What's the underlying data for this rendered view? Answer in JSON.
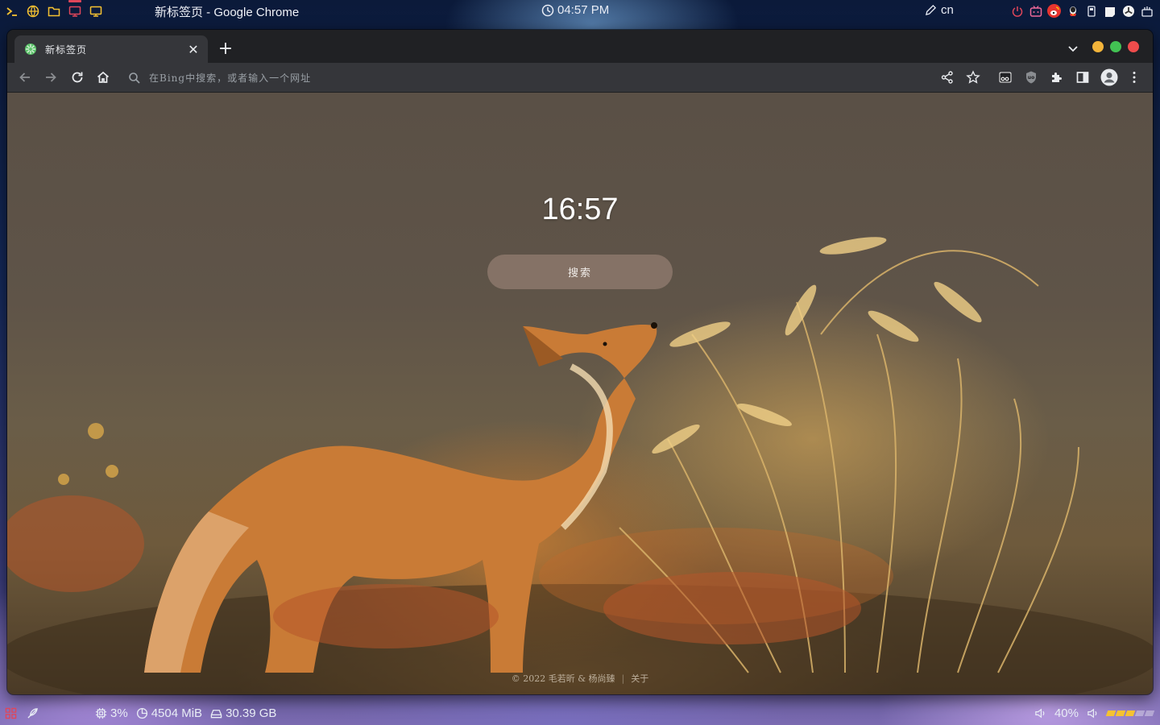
{
  "top_panel": {
    "window_title": "新标签页 - Google Chrome",
    "clock": "04:57 PM",
    "ime": "cn",
    "launchers": [
      "terminal-icon",
      "browser-icon",
      "folder-icon",
      "monitor-icon",
      "display-icon"
    ],
    "tray": [
      "power-icon",
      "bilibili-icon",
      "weibo-icon",
      "qq-icon",
      "usb-icon",
      "notes-icon",
      "hub-icon",
      "tray-menu-icon"
    ]
  },
  "browser": {
    "tab": {
      "title": "新标签页",
      "close": "✕"
    },
    "new_tab": "+",
    "omnibox": {
      "placeholder": "在Bing中搜索，或者输入一个网址"
    }
  },
  "ntp": {
    "clock": "16:57",
    "search_button": "搜索",
    "footer": {
      "copyright": "© 2022 毛若昕 & 杨尚臻",
      "separator": "|",
      "about": "关于"
    }
  },
  "bottom_panel": {
    "cpu": "3%",
    "memory": "4504 MiB",
    "disk": "30.39 GB",
    "volume": "40%",
    "battery_level": 0.6
  },
  "colors": {
    "accent_red": "#e0465a",
    "win_min": "#f3b43a",
    "win_max": "#42c253",
    "win_close": "#ee4c4c",
    "battery": "#f5c232"
  }
}
